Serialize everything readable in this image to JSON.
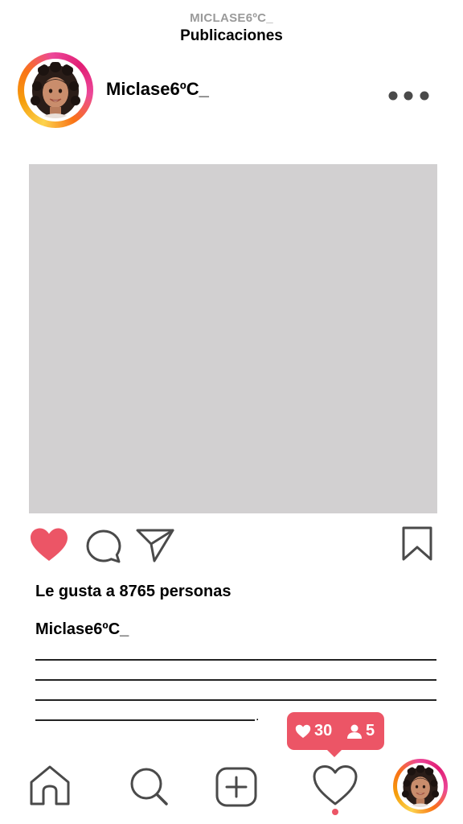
{
  "header": {
    "account_name": "MICLASE6ºC_",
    "title": "Publicaciones"
  },
  "post": {
    "username": "Miclase6ºC_",
    "avatar_icon": "memoji-avatar-icon",
    "more_icon": "more-options-icon",
    "likes_text": "Le gusta a 8765 personas",
    "caption_username": "Miclase6ºC_",
    "caption_line_end": "."
  },
  "actions": {
    "like_icon": "heart-filled-icon",
    "comment_icon": "comment-icon",
    "share_icon": "send-icon",
    "save_icon": "bookmark-icon"
  },
  "notifications": {
    "likes_count": "30",
    "followers_count": "5",
    "likes_icon": "heart-icon",
    "followers_icon": "person-icon"
  },
  "bottom_nav": {
    "items": [
      {
        "icon": "home-icon"
      },
      {
        "icon": "search-icon"
      },
      {
        "icon": "add-post-icon"
      },
      {
        "icon": "activity-heart-icon"
      },
      {
        "icon": "profile-avatar-icon"
      }
    ]
  },
  "colors": {
    "like_red": "#ec5566",
    "image_placeholder": "#d2d0d1",
    "ring_gradient": [
      "#fcd34d",
      "#f97316",
      "#ec4899"
    ]
  }
}
